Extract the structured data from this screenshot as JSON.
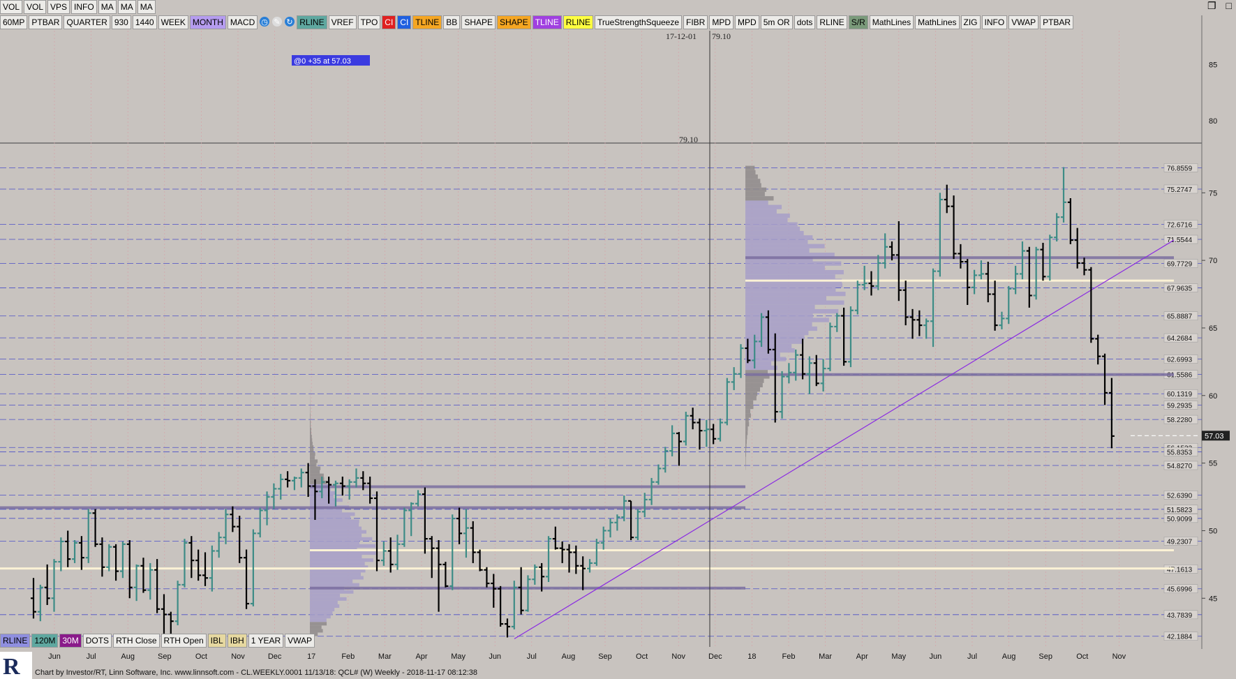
{
  "top_buttons": [
    "VOL",
    "VOL",
    "VPS",
    "INFO",
    "MA",
    "MA",
    "MA"
  ],
  "toolbar_buttons": [
    "60MP",
    "PTBAR",
    "QUARTER",
    "930",
    "1440",
    "WEEK",
    "MONTH",
    "MACD",
    "RLINE",
    "VREF",
    "TPO",
    "CI",
    "CI",
    "TLINE",
    "BB",
    "SHAPE",
    "SHAPE",
    "TLINE",
    "RLINE",
    "TrueStrengthSqueeze",
    "FIBR",
    "MPD",
    "MPD",
    "5m OR",
    "dots",
    "RLINE",
    "S/R",
    "MathLines",
    "MathLines",
    "ZIG",
    "INFO",
    "VWAP",
    "PTBAR"
  ],
  "bottom_buttons": [
    "RLINE",
    "120M",
    "30M",
    "DOTS",
    "RTH Close",
    "RTH Open",
    "IBL",
    "IBH",
    "1 YEAR",
    "VWAP"
  ],
  "footer_text": "Chart by Investor/RT, Linn Software, Inc. www.linnsoft.com - CL.WEEKLY.0001   11/13/18: QCL# (W) Weekly - 2018-11-17 08:12:38",
  "colors": {
    "background": "#c8c3bf",
    "bull_bar": "#3d8c86",
    "bear_bar": "#000000",
    "profile": "#a79fc8",
    "profile_gray": "#8e8a8a",
    "trendline": "#8a2be2",
    "sr_line": "#7b6fa0",
    "poc_line": "#fbf2d5"
  },
  "chart_data": {
    "type": "ohlc",
    "symbol": "CL",
    "timeframe": "Weekly",
    "crosshair_date": "17-12-01",
    "crosshair_value": "79.10",
    "annotation": "@0  +35 at 57.03",
    "current_price": "57.03",
    "upper_pane": {
      "ylim": [
        78,
        88
      ],
      "ticks": [
        80,
        85
      ]
    },
    "ylim": [
      41.4,
      77.7
    ],
    "y_ticks": [
      45,
      50,
      55,
      60,
      65,
      70,
      75
    ],
    "x_labels": [
      "Jun",
      "Jul",
      "Aug",
      "Sep",
      "Oct",
      "Nov",
      "Dec",
      "17",
      "Feb",
      "Mar",
      "Apr",
      "May",
      "Jun",
      "Jul",
      "Aug",
      "Sep",
      "Oct",
      "Nov",
      "Dec",
      "18",
      "Feb",
      "Mar",
      "Apr",
      "May",
      "Jun",
      "Jul",
      "Aug",
      "Sep",
      "Oct",
      "Nov"
    ],
    "level_labels": [
      "76.8559",
      "75.2747",
      "72.6716",
      "71.5544",
      "69.7729",
      "67.9635",
      "65.8887",
      "64.2684",
      "62.6993",
      "61.5586",
      "60.1319",
      "59.2935",
      "58.2280",
      "56.1533",
      "55.8353",
      "54.8270",
      "52.6390",
      "51.5823",
      "50.9099",
      "49.2307",
      "47.1613",
      "45.6996",
      "43.7839",
      "42.1884"
    ],
    "support_resistance": [
      70.2,
      61.55,
      53.25,
      51.7,
      45.75
    ],
    "poc_levels": [
      68.5,
      48.55,
      47.2
    ],
    "trendline": {
      "from": [
        0.0,
        42.0
      ],
      "to": [
        1.0,
        71.5
      ]
    },
    "weeks": [
      {
        "o": 45.0,
        "h": 46.5,
        "l": 43.5,
        "c": 44.0
      },
      {
        "o": 44.0,
        "h": 46.0,
        "l": 43.3,
        "c": 45.8
      },
      {
        "o": 45.8,
        "h": 47.5,
        "l": 44.5,
        "c": 45.0
      },
      {
        "o": 45.0,
        "h": 47.9,
        "l": 44.0,
        "c": 47.7
      },
      {
        "o": 47.7,
        "h": 49.5,
        "l": 47.0,
        "c": 49.2
      },
      {
        "o": 49.2,
        "h": 50.0,
        "l": 47.3,
        "c": 47.9
      },
      {
        "o": 47.9,
        "h": 49.3,
        "l": 47.6,
        "c": 49.1
      },
      {
        "o": 49.1,
        "h": 49.6,
        "l": 47.1,
        "c": 48.0
      },
      {
        "o": 48.0,
        "h": 51.6,
        "l": 47.6,
        "c": 51.3
      },
      {
        "o": 51.3,
        "h": 51.6,
        "l": 48.8,
        "c": 49.0
      },
      {
        "o": 49.0,
        "h": 49.5,
        "l": 46.6,
        "c": 47.3
      },
      {
        "o": 47.3,
        "h": 49.0,
        "l": 47.0,
        "c": 48.8
      },
      {
        "o": 48.8,
        "h": 49.0,
        "l": 46.3,
        "c": 47.0
      },
      {
        "o": 47.0,
        "h": 49.2,
        "l": 46.5,
        "c": 49.0
      },
      {
        "o": 49.0,
        "h": 49.3,
        "l": 45.0,
        "c": 45.8
      },
      {
        "o": 45.8,
        "h": 47.5,
        "l": 44.8,
        "c": 47.4
      },
      {
        "o": 47.4,
        "h": 48.0,
        "l": 45.4,
        "c": 45.6
      },
      {
        "o": 45.6,
        "h": 47.6,
        "l": 44.9,
        "c": 47.1
      },
      {
        "o": 47.1,
        "h": 47.9,
        "l": 43.9,
        "c": 44.2
      },
      {
        "o": 44.2,
        "h": 45.3,
        "l": 42.1,
        "c": 43.8
      },
      {
        "o": 43.8,
        "h": 44.0,
        "l": 41.5,
        "c": 43.3
      },
      {
        "o": 43.3,
        "h": 46.3,
        "l": 43.0,
        "c": 46.0
      },
      {
        "o": 46.0,
        "h": 49.4,
        "l": 45.8,
        "c": 49.1
      },
      {
        "o": 49.1,
        "h": 49.6,
        "l": 46.5,
        "c": 47.8
      },
      {
        "o": 47.8,
        "h": 48.6,
        "l": 46.3,
        "c": 46.7
      },
      {
        "o": 46.7,
        "h": 48.4,
        "l": 45.9,
        "c": 46.5
      },
      {
        "o": 46.5,
        "h": 48.9,
        "l": 45.5,
        "c": 48.5
      },
      {
        "o": 48.5,
        "h": 49.9,
        "l": 48.0,
        "c": 49.5
      },
      {
        "o": 49.5,
        "h": 51.6,
        "l": 49.0,
        "c": 51.2
      },
      {
        "o": 51.2,
        "h": 51.8,
        "l": 49.9,
        "c": 50.3
      },
      {
        "o": 50.3,
        "h": 51.1,
        "l": 47.6,
        "c": 48.0
      },
      {
        "o": 48.0,
        "h": 48.6,
        "l": 44.2,
        "c": 44.6
      },
      {
        "o": 44.6,
        "h": 50.1,
        "l": 44.4,
        "c": 49.8
      },
      {
        "o": 49.8,
        "h": 51.7,
        "l": 49.5,
        "c": 51.5
      },
      {
        "o": 51.5,
        "h": 52.9,
        "l": 50.4,
        "c": 52.5
      },
      {
        "o": 52.5,
        "h": 53.5,
        "l": 51.6,
        "c": 53.1
      },
      {
        "o": 53.1,
        "h": 54.2,
        "l": 52.3,
        "c": 53.8
      },
      {
        "o": 53.8,
        "h": 54.4,
        "l": 53.2,
        "c": 53.7
      },
      {
        "o": 53.7,
        "h": 54.0,
        "l": 53.0,
        "c": 53.9
      },
      {
        "o": 53.9,
        "h": 54.6,
        "l": 53.2,
        "c": 54.3
      },
      {
        "o": 54.3,
        "h": 55.0,
        "l": 52.5,
        "c": 53.3
      },
      {
        "o": 53.3,
        "h": 53.8,
        "l": 50.8,
        "c": 52.9
      },
      {
        "o": 52.9,
        "h": 54.0,
        "l": 52.4,
        "c": 53.6
      },
      {
        "o": 53.6,
        "h": 54.0,
        "l": 52.0,
        "c": 53.4
      },
      {
        "o": 53.4,
        "h": 53.7,
        "l": 51.8,
        "c": 53.5
      },
      {
        "o": 53.5,
        "h": 54.0,
        "l": 52.6,
        "c": 53.3
      },
      {
        "o": 53.3,
        "h": 53.8,
        "l": 52.3,
        "c": 53.6
      },
      {
        "o": 53.6,
        "h": 54.6,
        "l": 53.2,
        "c": 53.9
      },
      {
        "o": 53.9,
        "h": 54.4,
        "l": 53.0,
        "c": 53.5
      },
      {
        "o": 53.5,
        "h": 54.0,
        "l": 52.0,
        "c": 52.4
      },
      {
        "o": 52.4,
        "h": 52.9,
        "l": 47.0,
        "c": 47.8
      },
      {
        "o": 47.8,
        "h": 49.2,
        "l": 47.4,
        "c": 48.5
      },
      {
        "o": 48.5,
        "h": 49.5,
        "l": 46.9,
        "c": 47.5
      },
      {
        "o": 47.5,
        "h": 49.7,
        "l": 47.1,
        "c": 49.0
      },
      {
        "o": 49.0,
        "h": 51.7,
        "l": 48.8,
        "c": 51.5
      },
      {
        "o": 51.5,
        "h": 52.1,
        "l": 49.6,
        "c": 52.0
      },
      {
        "o": 52.0,
        "h": 53.0,
        "l": 51.8,
        "c": 52.7
      },
      {
        "o": 52.7,
        "h": 53.2,
        "l": 48.3,
        "c": 49.4
      },
      {
        "o": 49.4,
        "h": 49.6,
        "l": 46.5,
        "c": 48.7
      },
      {
        "o": 48.7,
        "h": 49.3,
        "l": 44.0,
        "c": 47.5
      },
      {
        "o": 47.5,
        "h": 47.7,
        "l": 45.8,
        "c": 45.9
      },
      {
        "o": 45.9,
        "h": 51.2,
        "l": 45.6,
        "c": 50.9
      },
      {
        "o": 50.9,
        "h": 51.7,
        "l": 49.0,
        "c": 49.8
      },
      {
        "o": 49.8,
        "h": 51.6,
        "l": 48.0,
        "c": 50.2
      },
      {
        "o": 50.2,
        "h": 50.7,
        "l": 47.6,
        "c": 48.4
      },
      {
        "o": 48.4,
        "h": 48.6,
        "l": 47.0,
        "c": 47.1
      },
      {
        "o": 47.1,
        "h": 47.3,
        "l": 45.8,
        "c": 46.1
      },
      {
        "o": 46.1,
        "h": 46.8,
        "l": 44.3,
        "c": 45.7
      },
      {
        "o": 45.7,
        "h": 45.9,
        "l": 42.9,
        "c": 43.1
      },
      {
        "o": 43.1,
        "h": 43.5,
        "l": 42.1,
        "c": 42.9
      },
      {
        "o": 42.9,
        "h": 46.3,
        "l": 42.7,
        "c": 45.8
      },
      {
        "o": 45.8,
        "h": 47.3,
        "l": 43.8,
        "c": 44.1
      },
      {
        "o": 44.1,
        "h": 46.7,
        "l": 44.0,
        "c": 46.4
      },
      {
        "o": 46.4,
        "h": 47.5,
        "l": 46.0,
        "c": 47.3
      },
      {
        "o": 47.3,
        "h": 47.6,
        "l": 45.5,
        "c": 46.6
      },
      {
        "o": 46.6,
        "h": 49.6,
        "l": 46.2,
        "c": 49.4
      },
      {
        "o": 49.4,
        "h": 50.3,
        "l": 48.6,
        "c": 48.7
      },
      {
        "o": 48.7,
        "h": 49.2,
        "l": 47.6,
        "c": 48.6
      },
      {
        "o": 48.6,
        "h": 49.0,
        "l": 46.9,
        "c": 48.4
      },
      {
        "o": 48.4,
        "h": 48.9,
        "l": 46.8,
        "c": 47.4
      },
      {
        "o": 47.4,
        "h": 48.1,
        "l": 45.6,
        "c": 47.2
      },
      {
        "o": 47.2,
        "h": 47.9,
        "l": 46.9,
        "c": 47.6
      },
      {
        "o": 47.6,
        "h": 49.4,
        "l": 47.4,
        "c": 49.1
      },
      {
        "o": 49.1,
        "h": 50.3,
        "l": 48.6,
        "c": 50.0
      },
      {
        "o": 50.0,
        "h": 50.9,
        "l": 49.5,
        "c": 50.6
      },
      {
        "o": 50.6,
        "h": 51.2,
        "l": 50.0,
        "c": 51.0
      },
      {
        "o": 51.0,
        "h": 52.6,
        "l": 50.7,
        "c": 52.2
      },
      {
        "o": 52.2,
        "h": 52.2,
        "l": 49.3,
        "c": 49.5
      },
      {
        "o": 49.5,
        "h": 51.6,
        "l": 49.3,
        "c": 51.4
      },
      {
        "o": 51.4,
        "h": 52.8,
        "l": 51.0,
        "c": 52.3
      },
      {
        "o": 52.3,
        "h": 53.9,
        "l": 51.9,
        "c": 53.6
      },
      {
        "o": 53.6,
        "h": 54.9,
        "l": 53.4,
        "c": 54.6
      },
      {
        "o": 54.6,
        "h": 56.2,
        "l": 54.3,
        "c": 55.9
      },
      {
        "o": 55.9,
        "h": 57.8,
        "l": 55.5,
        "c": 57.2
      },
      {
        "o": 57.2,
        "h": 57.3,
        "l": 54.8,
        "c": 56.6
      },
      {
        "o": 56.6,
        "h": 58.8,
        "l": 56.3,
        "c": 58.5
      },
      {
        "o": 58.5,
        "h": 59.1,
        "l": 57.5,
        "c": 58.0
      },
      {
        "o": 58.0,
        "h": 58.3,
        "l": 56.0,
        "c": 57.4
      },
      {
        "o": 57.4,
        "h": 58.2,
        "l": 56.2,
        "c": 57.5
      },
      {
        "o": 57.5,
        "h": 57.9,
        "l": 56.4,
        "c": 56.8
      },
      {
        "o": 56.8,
        "h": 58.3,
        "l": 56.6,
        "c": 58.0
      },
      {
        "o": 58.0,
        "h": 61.3,
        "l": 57.8,
        "c": 61.0
      },
      {
        "o": 61.0,
        "h": 62.1,
        "l": 60.4,
        "c": 61.6
      },
      {
        "o": 61.6,
        "h": 63.8,
        "l": 61.3,
        "c": 63.5
      },
      {
        "o": 63.5,
        "h": 64.2,
        "l": 62.4,
        "c": 62.6
      },
      {
        "o": 62.6,
        "h": 64.5,
        "l": 62.0,
        "c": 64.0
      },
      {
        "o": 64.0,
        "h": 66.1,
        "l": 63.6,
        "c": 65.8
      },
      {
        "o": 65.8,
        "h": 66.3,
        "l": 63.1,
        "c": 63.4
      },
      {
        "o": 63.4,
        "h": 64.6,
        "l": 58.0,
        "c": 58.8
      },
      {
        "o": 58.8,
        "h": 61.8,
        "l": 58.3,
        "c": 61.4
      },
      {
        "o": 61.4,
        "h": 62.4,
        "l": 60.9,
        "c": 61.7
      },
      {
        "o": 61.7,
        "h": 63.4,
        "l": 61.1,
        "c": 63.0
      },
      {
        "o": 63.0,
        "h": 64.2,
        "l": 61.2,
        "c": 61.6
      },
      {
        "o": 61.6,
        "h": 62.9,
        "l": 60.1,
        "c": 62.4
      },
      {
        "o": 62.4,
        "h": 63.0,
        "l": 60.7,
        "c": 60.9
      },
      {
        "o": 60.9,
        "h": 62.7,
        "l": 60.3,
        "c": 62.0
      },
      {
        "o": 62.0,
        "h": 65.4,
        "l": 61.8,
        "c": 65.1
      },
      {
        "o": 65.1,
        "h": 66.1,
        "l": 64.7,
        "c": 65.9
      },
      {
        "o": 65.9,
        "h": 66.5,
        "l": 62.2,
        "c": 62.5
      },
      {
        "o": 62.5,
        "h": 66.6,
        "l": 62.1,
        "c": 66.3
      },
      {
        "o": 66.3,
        "h": 68.5,
        "l": 66.0,
        "c": 68.2
      },
      {
        "o": 68.2,
        "h": 69.6,
        "l": 67.8,
        "c": 68.3
      },
      {
        "o": 68.3,
        "h": 69.2,
        "l": 67.4,
        "c": 68.1
      },
      {
        "o": 68.1,
        "h": 70.4,
        "l": 67.8,
        "c": 69.8
      },
      {
        "o": 69.8,
        "h": 72.0,
        "l": 69.4,
        "c": 71.0
      },
      {
        "o": 71.0,
        "h": 71.4,
        "l": 70.0,
        "c": 70.4
      },
      {
        "o": 70.4,
        "h": 72.9,
        "l": 67.0,
        "c": 67.8
      },
      {
        "o": 67.8,
        "h": 68.5,
        "l": 65.2,
        "c": 65.8
      },
      {
        "o": 65.8,
        "h": 66.4,
        "l": 64.2,
        "c": 65.6
      },
      {
        "o": 65.6,
        "h": 66.3,
        "l": 64.4,
        "c": 65.2
      },
      {
        "o": 65.2,
        "h": 65.7,
        "l": 64.2,
        "c": 65.5
      },
      {
        "o": 65.5,
        "h": 69.4,
        "l": 63.6,
        "c": 69.2
      },
      {
        "o": 69.2,
        "h": 75.0,
        "l": 68.8,
        "c": 74.5
      },
      {
        "o": 74.5,
        "h": 75.6,
        "l": 73.5,
        "c": 74.0
      },
      {
        "o": 74.0,
        "h": 74.8,
        "l": 70.1,
        "c": 70.5
      },
      {
        "o": 70.5,
        "h": 71.2,
        "l": 69.4,
        "c": 69.9
      },
      {
        "o": 69.9,
        "h": 70.1,
        "l": 66.7,
        "c": 68.0
      },
      {
        "o": 68.0,
        "h": 69.3,
        "l": 67.5,
        "c": 68.9
      },
      {
        "o": 68.9,
        "h": 70.0,
        "l": 68.6,
        "c": 69.0
      },
      {
        "o": 69.0,
        "h": 69.9,
        "l": 66.9,
        "c": 67.5
      },
      {
        "o": 67.5,
        "h": 68.5,
        "l": 64.8,
        "c": 65.2
      },
      {
        "o": 65.2,
        "h": 66.2,
        "l": 64.9,
        "c": 65.7
      },
      {
        "o": 65.7,
        "h": 68.1,
        "l": 65.3,
        "c": 67.9
      },
      {
        "o": 67.9,
        "h": 69.6,
        "l": 67.5,
        "c": 69.0
      },
      {
        "o": 69.0,
        "h": 71.4,
        "l": 68.6,
        "c": 70.7
      },
      {
        "o": 70.7,
        "h": 71.0,
        "l": 66.5,
        "c": 67.4
      },
      {
        "o": 67.4,
        "h": 71.0,
        "l": 67.1,
        "c": 70.8
      },
      {
        "o": 70.8,
        "h": 71.3,
        "l": 68.5,
        "c": 68.8
      },
      {
        "o": 68.8,
        "h": 71.9,
        "l": 68.5,
        "c": 71.7
      },
      {
        "o": 71.7,
        "h": 73.5,
        "l": 71.4,
        "c": 73.2
      },
      {
        "o": 73.2,
        "h": 76.9,
        "l": 72.8,
        "c": 74.3
      },
      {
        "o": 74.3,
        "h": 74.6,
        "l": 71.2,
        "c": 71.5
      },
      {
        "o": 71.5,
        "h": 72.4,
        "l": 69.4,
        "c": 69.8
      },
      {
        "o": 69.8,
        "h": 70.2,
        "l": 68.9,
        "c": 69.3
      },
      {
        "o": 69.3,
        "h": 69.5,
        "l": 63.9,
        "c": 64.2
      },
      {
        "o": 64.2,
        "h": 64.5,
        "l": 62.3,
        "c": 62.9
      },
      {
        "o": 62.9,
        "h": 63.1,
        "l": 59.3,
        "c": 60.2
      },
      {
        "o": 60.2,
        "h": 61.3,
        "l": 56.1,
        "c": 57.0
      }
    ]
  }
}
